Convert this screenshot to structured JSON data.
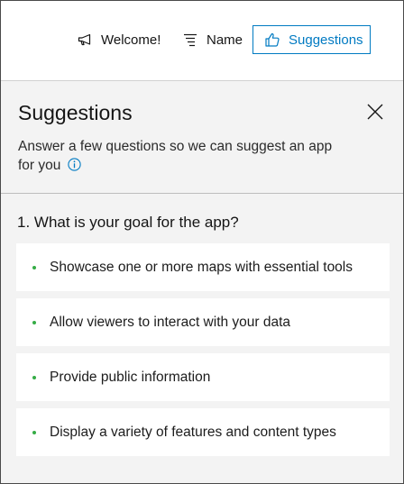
{
  "topbar": {
    "welcome_label": "Welcome!",
    "welcome_icon": "megaphone-icon",
    "name_label": "Name",
    "name_icon": "text-lines-icon",
    "suggestions_label": "Suggestions",
    "suggestions_icon": "thumbs-up-icon"
  },
  "panel": {
    "title": "Suggestions",
    "description": "Answer a few questions so we can suggest an app for you",
    "info_icon": "info-icon",
    "close_icon": "close-icon"
  },
  "question": {
    "text": "1. What is your goal for the app?",
    "options": [
      "Showcase one or more maps with essential tools",
      "Allow viewers to interact with your data",
      "Provide public information",
      "Display a variety of features and content types"
    ]
  },
  "colors": {
    "accent": "#007ac2",
    "bullet": "#35ac46",
    "panel_bg": "#f3f3f3"
  }
}
